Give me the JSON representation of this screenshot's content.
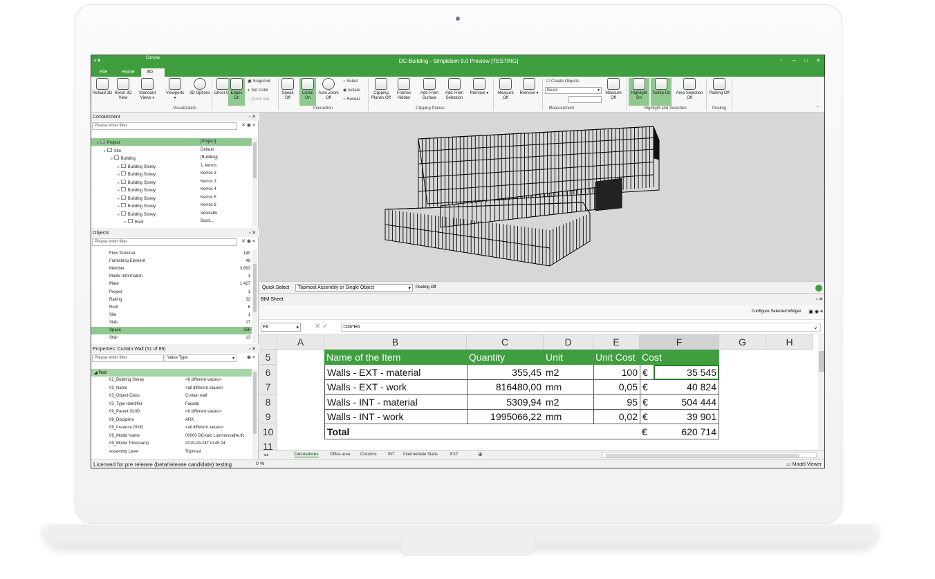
{
  "app": {
    "title": "DC-Building - Simplebim 9.0 Preview [TESTING]",
    "canvas_group": "Canvas"
  },
  "tabs": [
    "File",
    "Home",
    "3D"
  ],
  "ribbon": {
    "buttons": [
      {
        "id": "reload",
        "label": "Reload 3D"
      },
      {
        "id": "reset",
        "label": "Reset 3D View"
      },
      {
        "id": "std",
        "label": "Standard Views ▾"
      },
      {
        "id": "viewports",
        "label": "Viewports ▾"
      },
      {
        "id": "options",
        "label": "3D Options"
      },
      {
        "id": "ghost",
        "label": "Ghost Off"
      },
      {
        "id": "edges",
        "label": "Edges On"
      },
      {
        "id": "speak",
        "label": "Speak Off"
      },
      {
        "id": "listen",
        "label": "Listen On"
      },
      {
        "id": "autozoom",
        "label": "Auto Zoom Off"
      },
      {
        "id": "clipping",
        "label": "Clipping Planes Off"
      },
      {
        "id": "frames",
        "label": "Frames Hidden"
      },
      {
        "id": "addsurface",
        "label": "Add From Surface"
      },
      {
        "id": "addsel",
        "label": "Add From Selection"
      },
      {
        "id": "remove",
        "label": "Remove ▾"
      },
      {
        "id": "measure",
        "label": "Measure Off"
      },
      {
        "id": "mremove",
        "label": "Remove ▾"
      },
      {
        "id": "measure2",
        "label": "Measure Off"
      },
      {
        "id": "highlight",
        "label": "Highlight On"
      },
      {
        "id": "tooltip",
        "label": "Tooltip On"
      },
      {
        "id": "area",
        "label": "Area Selection Off"
      },
      {
        "id": "peeling",
        "label": "Peeling Off"
      }
    ],
    "small": {
      "snapshot": "Snapshot",
      "setcolor": "Set Color",
      "quickset": "Quick Set",
      "select": "Select",
      "isolate": "Isolate",
      "reveal": "Reveal",
      "create_objects": "Create Objects",
      "beam": "Beam"
    },
    "groups": {
      "visualization": "Visualization",
      "interaction": "Interaction",
      "clipping": "Clipping Planes",
      "measurement": "Measurement",
      "highlight": "Highlight and Selection",
      "peeling": "Peeling"
    }
  },
  "containment": {
    "title": "Containment",
    "filter": "Please enter filter",
    "rows": [
      {
        "name": "Project",
        "value": "[Project]"
      },
      {
        "name": "Site",
        "value": "Default"
      },
      {
        "name": "Building",
        "value": "[Building]"
      },
      {
        "name": "Building Storey",
        "value": "1. kerros"
      },
      {
        "name": "Building Storey",
        "value": "Kerros 2"
      },
      {
        "name": "Building Storey",
        "value": "Kerros 3"
      },
      {
        "name": "Building Storey",
        "value": "Kerros 4"
      },
      {
        "name": "Building Storey",
        "value": "Kerros 5"
      },
      {
        "name": "Building Storey",
        "value": "Kerros 6"
      },
      {
        "name": "Building Storey",
        "value": "Vesikatto"
      },
      {
        "name": "Roof",
        "value": "Basic..."
      }
    ]
  },
  "objects": {
    "title": "Objects",
    "filter": "Please enter filter",
    "rows": [
      {
        "name": "Flow Terminal",
        "count": "140"
      },
      {
        "name": "Furnishing Element",
        "count": "49"
      },
      {
        "name": "Member",
        "count": "3 893"
      },
      {
        "name": "Model Information",
        "count": "1"
      },
      {
        "name": "Plate",
        "count": "1 427"
      },
      {
        "name": "Project",
        "count": "1"
      },
      {
        "name": "Railing",
        "count": "32"
      },
      {
        "name": "Roof",
        "count": "6"
      },
      {
        "name": "Site",
        "count": "1"
      },
      {
        "name": "Slab",
        "count": "17"
      },
      {
        "name": "Space",
        "count": "256"
      },
      {
        "name": "Stair",
        "count": "13"
      }
    ]
  },
  "properties": {
    "title": "Properties: Curtain Wall (31 of 89)",
    "filter": "Please enter filter",
    "value_type": "Value Type",
    "section": "Text",
    "rows": [
      {
        "name": "02_Building Storey",
        "value": "<6 different values>"
      },
      {
        "name": "03_Name",
        "value": "<all different values>"
      },
      {
        "name": "03_Object Class",
        "value": "Curtain wall"
      },
      {
        "name": "03_Type Identifier",
        "value": "Facade"
      },
      {
        "name": "09_Parent GUID",
        "value": "<6 different values>"
      },
      {
        "name": "09_Discipline",
        "value": "ARK"
      },
      {
        "name": "09_Instance GUID",
        "value": "<all different values>"
      },
      {
        "name": "09_Model Name",
        "value": "00000 DC-talo Luonnosvaihe.ifc"
      },
      {
        "name": "09_Model Timestamp",
        "value": "2019-09-24T10:45:24"
      },
      {
        "name": "Assembly Level",
        "value": "Topmost"
      }
    ]
  },
  "quickselect": {
    "label": "Quick Select",
    "value": "Topmost Assembly or Single Object",
    "peeling": "Peeling Off"
  },
  "bim": {
    "title": "BIM Sheet",
    "configure": "Configure Selected Widget",
    "cellref": "F6",
    "formula": "=D6*E6"
  },
  "sheet": {
    "columns": [
      "A",
      "B",
      "C",
      "D",
      "E",
      "F",
      "G",
      "H"
    ],
    "rownums": [
      "5",
      "6",
      "7",
      "8",
      "9",
      "10",
      "11"
    ],
    "header": {
      "name": "Name of the Item",
      "qty": "Quantity",
      "unit": "Unit",
      "ucost": "Unit Cost",
      "cost": "Cost"
    },
    "rows": [
      {
        "name": "Walls - EXT - material",
        "qty": "355,45",
        "unit": "m2",
        "ucost": "100",
        "cur": "€",
        "cost": "35 545"
      },
      {
        "name": "Walls - EXT - work",
        "qty": "816480,00",
        "unit": "mm",
        "ucost": "0,05",
        "cur": "€",
        "cost": "40 824"
      },
      {
        "name": "Walls - INT - material",
        "qty": "5309,94",
        "unit": "m2",
        "ucost": "95",
        "cur": "€",
        "cost": "504 444"
      },
      {
        "name": "Walls - INT - work",
        "qty": "1995066,22",
        "unit": "mm",
        "ucost": "0,02",
        "cur": "€",
        "cost": "39 901"
      }
    ],
    "total": {
      "label": "Total",
      "cur": "€",
      "value": "620 714"
    },
    "tabs": [
      "Calculations",
      "Office area",
      "Columns",
      "INT",
      "Intermediate Slabs",
      "EXT"
    ]
  },
  "status": {
    "license": "Licensed for pre release (beta/release candidate) testing",
    "progress": "0 %",
    "model_viewer": "Model Viewer"
  }
}
